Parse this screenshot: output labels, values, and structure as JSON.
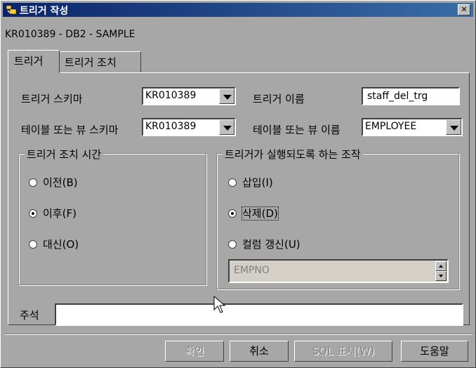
{
  "window": {
    "title": "트리거 작성",
    "close_glyph": "✕",
    "connection": "KR010389 - DB2 - SAMPLE"
  },
  "tabs": [
    {
      "label": "트리거",
      "active": true
    },
    {
      "label": "트리거 조치",
      "active": false
    }
  ],
  "form": {
    "trigger_schema_label": "트리거 스키마",
    "trigger_schema_value": "KR010389",
    "trigger_name_label": "트리거 이름",
    "trigger_name_value": "staff_del_trg",
    "table_schema_label": "테이블 또는 뷰 스키마",
    "table_schema_value": "KR010389",
    "table_name_label": "테이블 또는 뷰 이름",
    "table_name_value": "EMPLOYEE"
  },
  "timing_group": {
    "title": "트리거 조치 시간",
    "options": [
      {
        "label": "이전(B)",
        "selected": false
      },
      {
        "label": "이후(F)",
        "selected": true
      },
      {
        "label": "대신(O)",
        "selected": false
      }
    ]
  },
  "operation_group": {
    "title": "트리거가 실행되도록 하는 조작",
    "options": [
      {
        "label": "삽입(I)",
        "selected": false
      },
      {
        "label": "삭제(D)",
        "selected": true
      },
      {
        "label": "컬럼 갱신(U)",
        "selected": false
      }
    ],
    "column_value": "EMPNO"
  },
  "comment": {
    "label": "주석",
    "value": ""
  },
  "buttons": {
    "ok": "확인",
    "cancel": "취소",
    "show_sql": "SQL 표시(W)",
    "help": "도움말"
  },
  "icons": {
    "title_icon": "trigger-app-icon",
    "cursor": "mouse-pointer-icon"
  }
}
